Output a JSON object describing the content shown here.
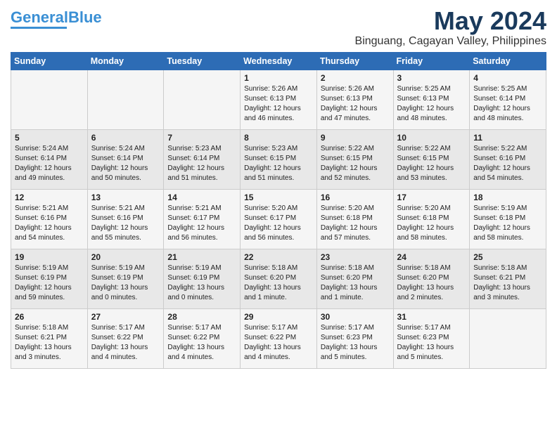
{
  "header": {
    "logo_line1": "General",
    "logo_line2": "Blue",
    "month": "May 2024",
    "location": "Binguang, Cagayan Valley, Philippines"
  },
  "days_of_week": [
    "Sunday",
    "Monday",
    "Tuesday",
    "Wednesday",
    "Thursday",
    "Friday",
    "Saturday"
  ],
  "weeks": [
    [
      {
        "day": "",
        "content": ""
      },
      {
        "day": "",
        "content": ""
      },
      {
        "day": "",
        "content": ""
      },
      {
        "day": "1",
        "content": "Sunrise: 5:26 AM\nSunset: 6:13 PM\nDaylight: 12 hours\nand 46 minutes."
      },
      {
        "day": "2",
        "content": "Sunrise: 5:26 AM\nSunset: 6:13 PM\nDaylight: 12 hours\nand 47 minutes."
      },
      {
        "day": "3",
        "content": "Sunrise: 5:25 AM\nSunset: 6:13 PM\nDaylight: 12 hours\nand 48 minutes."
      },
      {
        "day": "4",
        "content": "Sunrise: 5:25 AM\nSunset: 6:14 PM\nDaylight: 12 hours\nand 48 minutes."
      }
    ],
    [
      {
        "day": "5",
        "content": "Sunrise: 5:24 AM\nSunset: 6:14 PM\nDaylight: 12 hours\nand 49 minutes."
      },
      {
        "day": "6",
        "content": "Sunrise: 5:24 AM\nSunset: 6:14 PM\nDaylight: 12 hours\nand 50 minutes."
      },
      {
        "day": "7",
        "content": "Sunrise: 5:23 AM\nSunset: 6:14 PM\nDaylight: 12 hours\nand 51 minutes."
      },
      {
        "day": "8",
        "content": "Sunrise: 5:23 AM\nSunset: 6:15 PM\nDaylight: 12 hours\nand 51 minutes."
      },
      {
        "day": "9",
        "content": "Sunrise: 5:22 AM\nSunset: 6:15 PM\nDaylight: 12 hours\nand 52 minutes."
      },
      {
        "day": "10",
        "content": "Sunrise: 5:22 AM\nSunset: 6:15 PM\nDaylight: 12 hours\nand 53 minutes."
      },
      {
        "day": "11",
        "content": "Sunrise: 5:22 AM\nSunset: 6:16 PM\nDaylight: 12 hours\nand 54 minutes."
      }
    ],
    [
      {
        "day": "12",
        "content": "Sunrise: 5:21 AM\nSunset: 6:16 PM\nDaylight: 12 hours\nand 54 minutes."
      },
      {
        "day": "13",
        "content": "Sunrise: 5:21 AM\nSunset: 6:16 PM\nDaylight: 12 hours\nand 55 minutes."
      },
      {
        "day": "14",
        "content": "Sunrise: 5:21 AM\nSunset: 6:17 PM\nDaylight: 12 hours\nand 56 minutes."
      },
      {
        "day": "15",
        "content": "Sunrise: 5:20 AM\nSunset: 6:17 PM\nDaylight: 12 hours\nand 56 minutes."
      },
      {
        "day": "16",
        "content": "Sunrise: 5:20 AM\nSunset: 6:18 PM\nDaylight: 12 hours\nand 57 minutes."
      },
      {
        "day": "17",
        "content": "Sunrise: 5:20 AM\nSunset: 6:18 PM\nDaylight: 12 hours\nand 58 minutes."
      },
      {
        "day": "18",
        "content": "Sunrise: 5:19 AM\nSunset: 6:18 PM\nDaylight: 12 hours\nand 58 minutes."
      }
    ],
    [
      {
        "day": "19",
        "content": "Sunrise: 5:19 AM\nSunset: 6:19 PM\nDaylight: 12 hours\nand 59 minutes."
      },
      {
        "day": "20",
        "content": "Sunrise: 5:19 AM\nSunset: 6:19 PM\nDaylight: 13 hours\nand 0 minutes."
      },
      {
        "day": "21",
        "content": "Sunrise: 5:19 AM\nSunset: 6:19 PM\nDaylight: 13 hours\nand 0 minutes."
      },
      {
        "day": "22",
        "content": "Sunrise: 5:18 AM\nSunset: 6:20 PM\nDaylight: 13 hours\nand 1 minute."
      },
      {
        "day": "23",
        "content": "Sunrise: 5:18 AM\nSunset: 6:20 PM\nDaylight: 13 hours\nand 1 minute."
      },
      {
        "day": "24",
        "content": "Sunrise: 5:18 AM\nSunset: 6:20 PM\nDaylight: 13 hours\nand 2 minutes."
      },
      {
        "day": "25",
        "content": "Sunrise: 5:18 AM\nSunset: 6:21 PM\nDaylight: 13 hours\nand 3 minutes."
      }
    ],
    [
      {
        "day": "26",
        "content": "Sunrise: 5:18 AM\nSunset: 6:21 PM\nDaylight: 13 hours\nand 3 minutes."
      },
      {
        "day": "27",
        "content": "Sunrise: 5:17 AM\nSunset: 6:22 PM\nDaylight: 13 hours\nand 4 minutes."
      },
      {
        "day": "28",
        "content": "Sunrise: 5:17 AM\nSunset: 6:22 PM\nDaylight: 13 hours\nand 4 minutes."
      },
      {
        "day": "29",
        "content": "Sunrise: 5:17 AM\nSunset: 6:22 PM\nDaylight: 13 hours\nand 4 minutes."
      },
      {
        "day": "30",
        "content": "Sunrise: 5:17 AM\nSunset: 6:23 PM\nDaylight: 13 hours\nand 5 minutes."
      },
      {
        "day": "31",
        "content": "Sunrise: 5:17 AM\nSunset: 6:23 PM\nDaylight: 13 hours\nand 5 minutes."
      },
      {
        "day": "",
        "content": ""
      }
    ]
  ]
}
